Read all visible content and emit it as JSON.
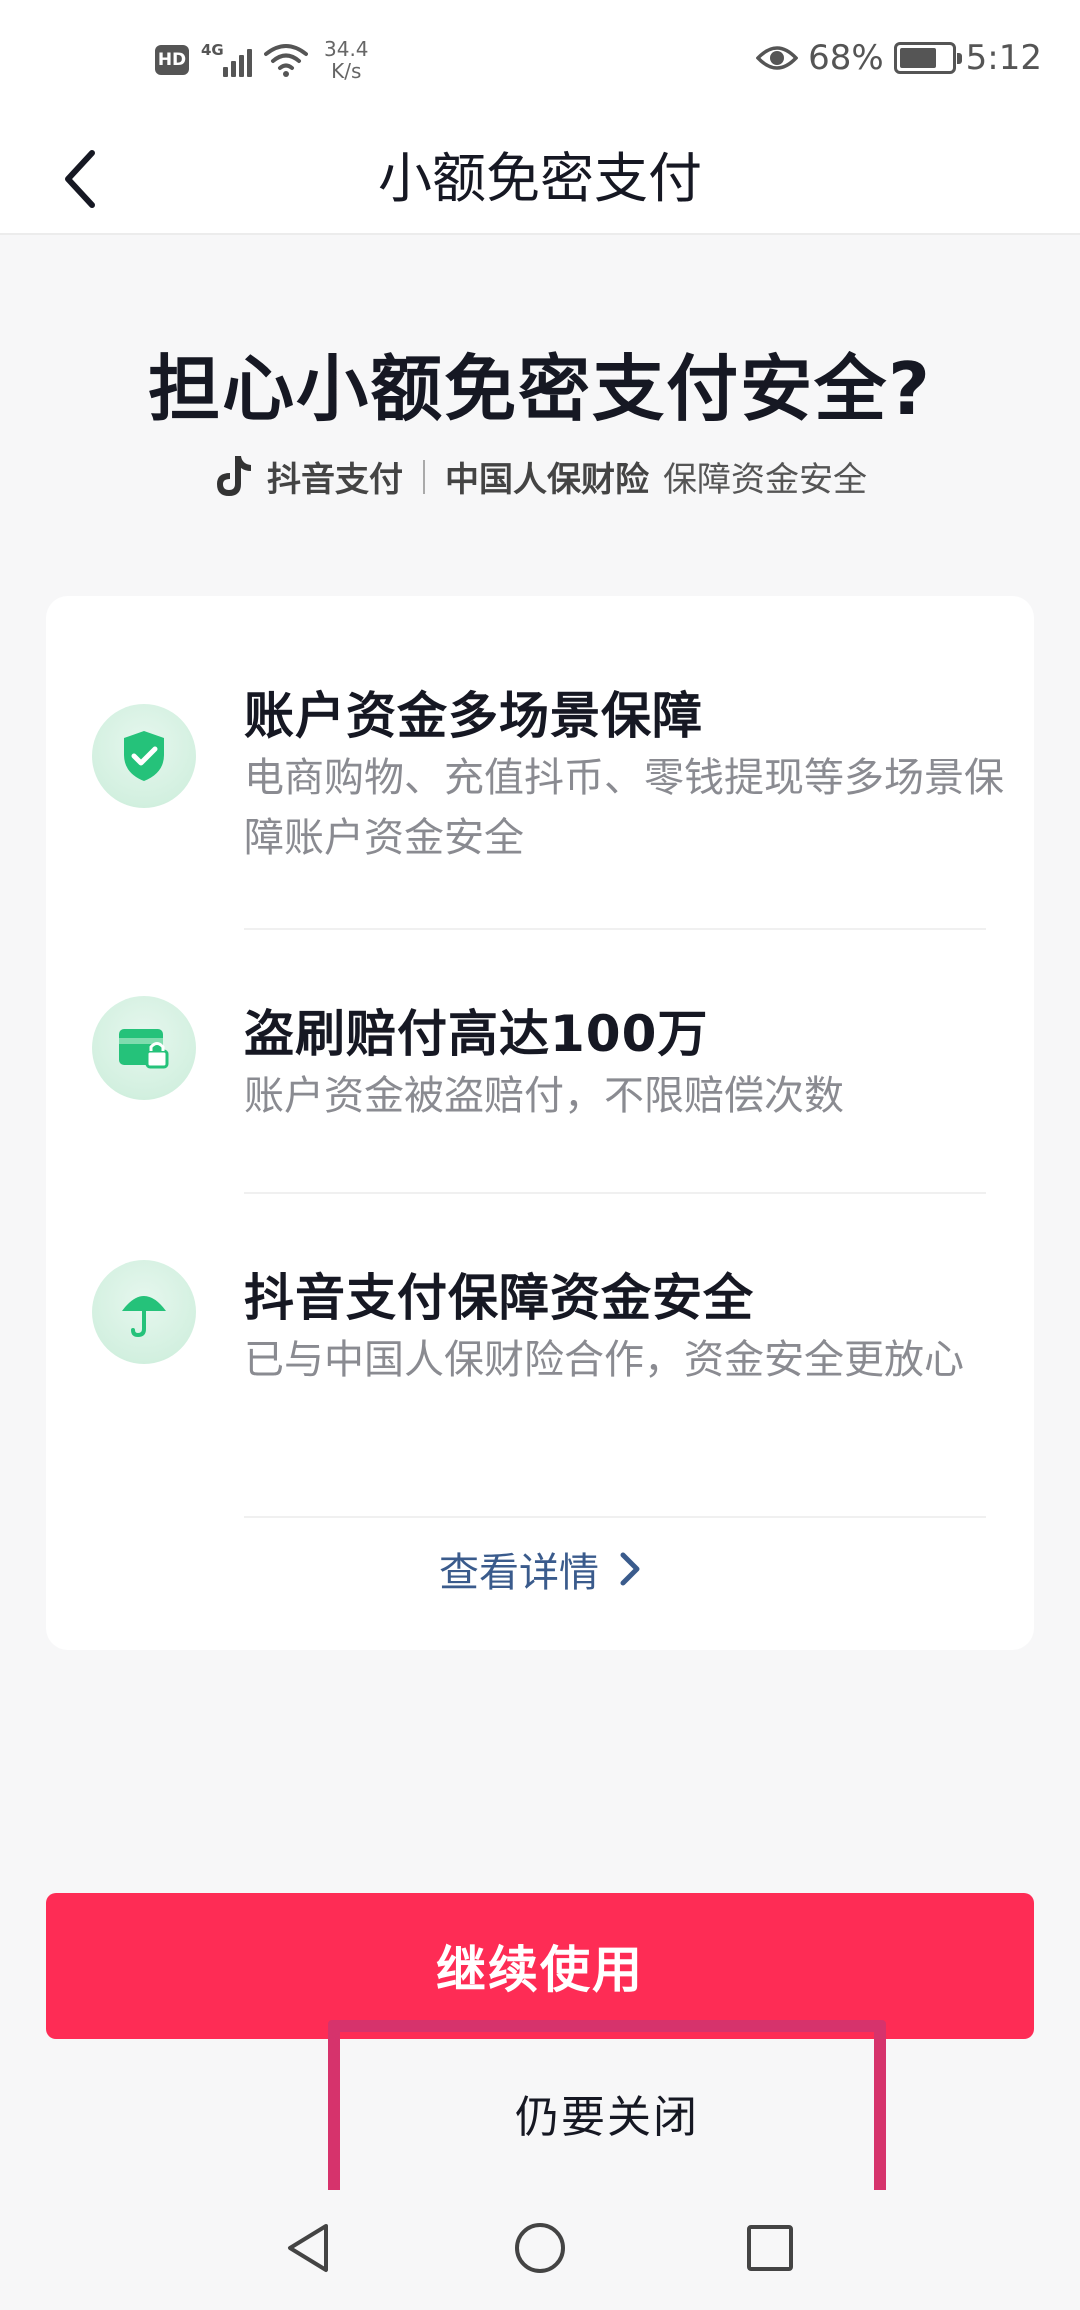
{
  "status_bar": {
    "hd": "HD",
    "network": "4G",
    "speed_value": "34.4",
    "speed_unit": "K/s",
    "battery": "68%",
    "time": "5:12"
  },
  "nav": {
    "title": "小额免密支付"
  },
  "hero": {
    "title": "担心小额免密支付安全?",
    "brand_pay": "抖音支付",
    "brand_insurer": "中国人保财险",
    "brand_tagline": "保障资金安全"
  },
  "features": [
    {
      "title": "账户资金多场景保障",
      "desc": "电商购物、充值抖币、零钱提现等多场景保障账户资金安全",
      "icon": "shield-check-icon"
    },
    {
      "title": "盗刷赔付高达100万",
      "desc": "账户资金被盗赔付，不限赔偿次数",
      "icon": "card-lock-icon"
    },
    {
      "title": "抖音支付保障资金安全",
      "desc": "已与中国人保财险合作，资金安全更放心",
      "icon": "umbrella-icon"
    }
  ],
  "details_link": "查看详情",
  "buttons": {
    "continue": "继续使用",
    "close": "仍要关闭"
  },
  "colors": {
    "primary": "#fe2c55",
    "accent_green": "#25c27a",
    "link": "#3a5b8c",
    "highlight_border": "#d6336c"
  }
}
